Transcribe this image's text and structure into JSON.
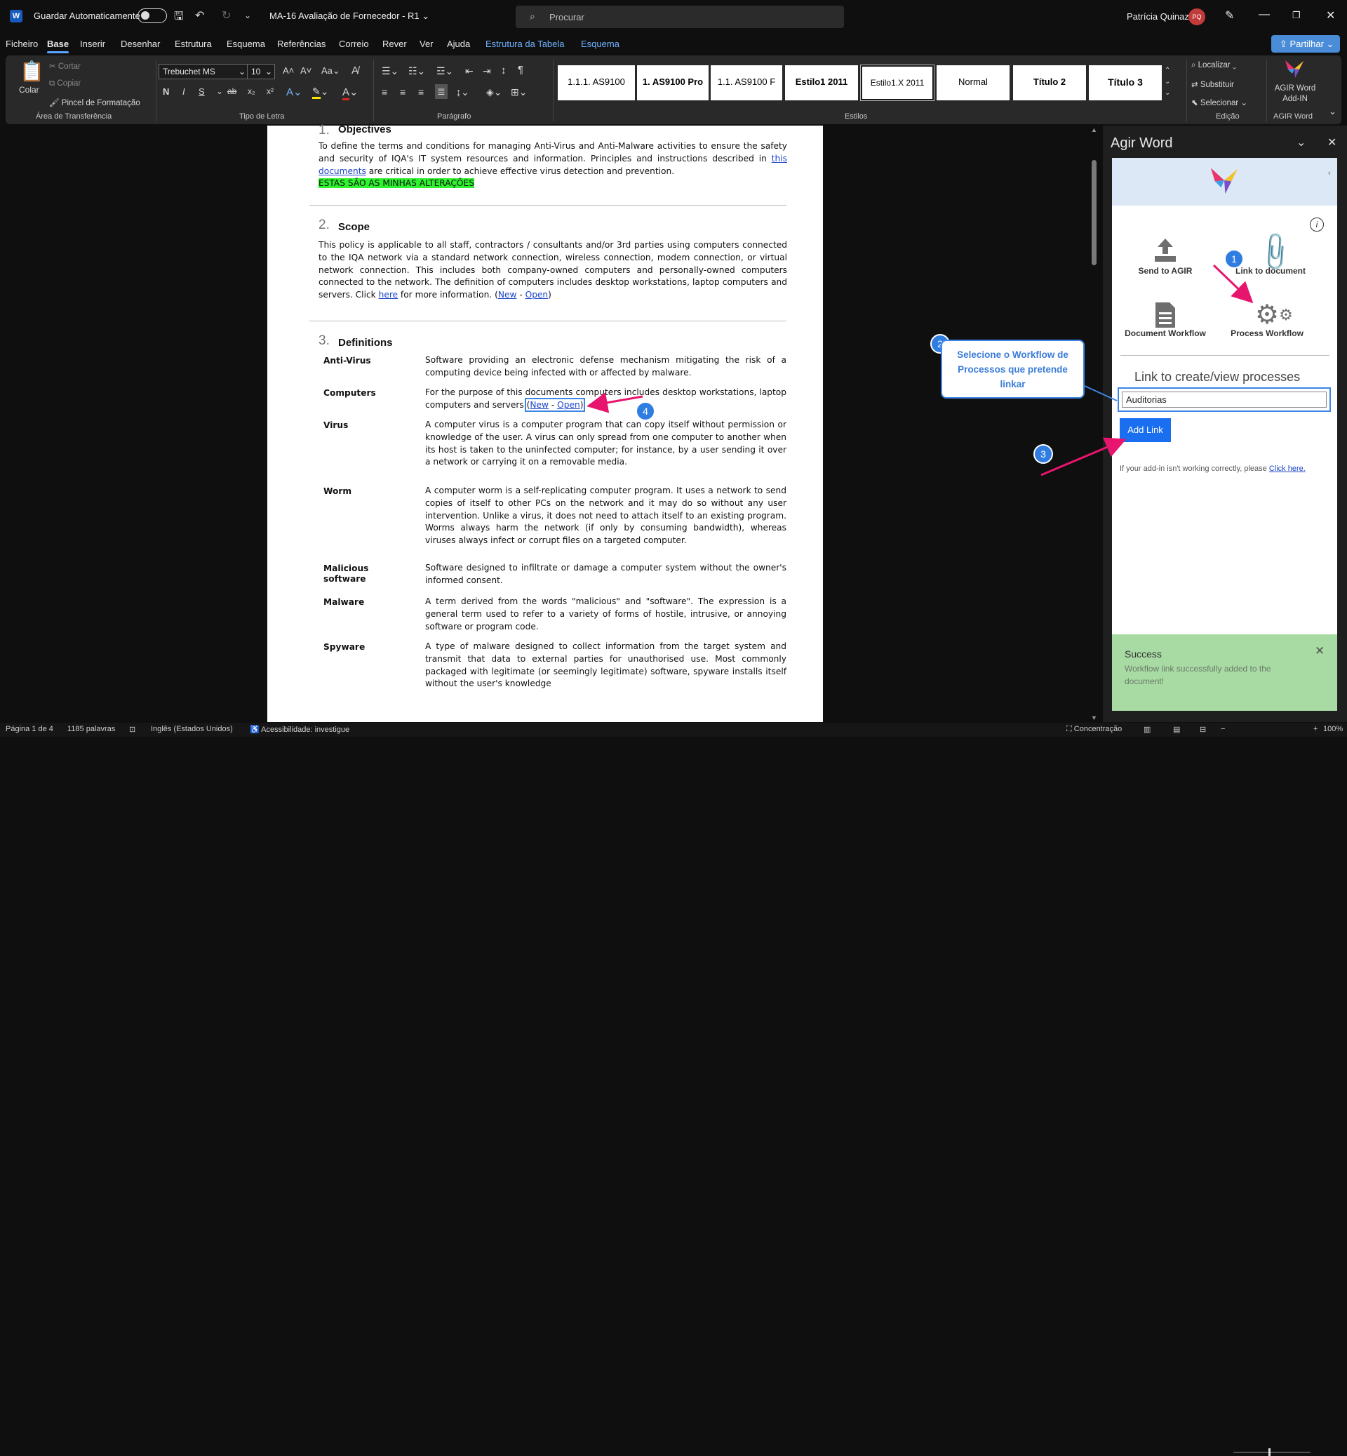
{
  "titlebar": {
    "app_icon": "W",
    "autosave_label": "Guardar Automaticamente",
    "doc_title": "MA-16 Avaliação de Fornecedor - R1",
    "search_placeholder": "Procurar",
    "user_name": "Patrícia Quinaz",
    "user_initials": "PQ"
  },
  "menu": {
    "tabs": [
      "Ficheiro",
      "Base",
      "Inserir",
      "Desenhar",
      "Estrutura",
      "Esquema",
      "Referências",
      "Correio",
      "Rever",
      "Ver",
      "Ajuda",
      "Estrutura da Tabela",
      "Esquema"
    ],
    "active_tab": "Base",
    "share_label": "Partilhar"
  },
  "ribbon": {
    "clipboard": {
      "paste": "Colar",
      "cut": "Cortar",
      "copy": "Copiar",
      "format_painter": "Pincel de Formatação",
      "group_label": "Área de Transferência"
    },
    "font": {
      "family": "Trebuchet MS",
      "size": "10",
      "change_case": "Aa",
      "bold": "N",
      "italic": "I",
      "underline": "S",
      "strike": "ab",
      "subscript": "x₂",
      "superscript": "x²",
      "group_label": "Tipo de Letra"
    },
    "paragraph": {
      "group_label": "Parágrafo"
    },
    "styles": {
      "items": [
        "1.1.1. AS9100",
        "1. AS9100 Pro",
        "1.1. AS9100 F",
        "Estilo1 2011",
        "Estilo1.X 2011",
        "Normal",
        "Título 2",
        "Título 3"
      ],
      "group_label": "Estilos"
    },
    "editing": {
      "find": "Localizar",
      "replace": "Substituir",
      "select": "Selecionar",
      "group_label": "Edição"
    },
    "agir": {
      "button_line1": "AGIR Word",
      "button_line2": "Add-IN",
      "group_label": "AGIR Word"
    }
  },
  "document": {
    "sections": [
      {
        "num": "1.",
        "title": "Objectives",
        "text_before": "To define the terms and conditions for managing Anti-Virus and Anti-Malware activities to ensure the safety and security of IQA's IT system resources and information. Principles and instructions described in ",
        "link": "this documents",
        "text_after": " are critical in order to achieve effective virus detection and prevention.",
        "highlight": "ESTAS SÃO AS MINHAS ALTERAÇÕES"
      },
      {
        "num": "2.",
        "title": "Scope",
        "text_before": "This policy is applicable to all staff, contractors / consultants and/or 3rd parties using computers connected to the IQA network via a standard network connection, wireless connection, modem connection, or virtual network connection. This includes both company-owned computers and personally-owned computers connected to the network. The definition of computers includes desktop workstations, laptop computers and servers. Click ",
        "link": "here",
        "text_after": " for more information. (",
        "link_new": "New",
        "link_sep": " - ",
        "link_open": "Open",
        "close": ")"
      },
      {
        "num": "3.",
        "title": "Definitions"
      }
    ],
    "definitions": [
      {
        "term": "Anti-Virus",
        "body": "Software providing an electronic defense mechanism mitigating the risk of a computing device being infected with or affected by malware."
      },
      {
        "term": "Computers",
        "body": "For the purpose of this documents computers includes desktop workstations, laptop computers and servers ",
        "link_new": "New",
        "link_open": "Open"
      },
      {
        "term": "Virus",
        "body": "A computer virus is a computer program that can copy itself without permission or knowledge of the user. A virus can only spread from one computer to another when its host is taken to the uninfected computer; for instance, by a user sending it over a network or carrying it on a removable media."
      },
      {
        "term": "Worm",
        "body": "A computer worm is a self-replicating computer program. It uses a network to send copies of itself to other PCs on the network and it may do so without any user intervention. Unlike a virus, it does not need to attach itself to an existing program. Worms always harm the network (if only by consuming bandwidth), whereas viruses always infect or corrupt files on a targeted computer."
      },
      {
        "term": "Malicious software",
        "body": "Software designed to infiltrate or damage a computer system without the owner's informed consent."
      },
      {
        "term": "Malware",
        "body": "A term derived from the words \"malicious\" and \"software\". The expression is a general term used to refer to a variety of forms of hostile, intrusive, or annoying software or program code."
      },
      {
        "term": "Spyware",
        "body": "A type of malware designed to collect information from the target system and transmit that data to external parties for unauthorised use. Most commonly packaged with legitimate (or seemingly legitimate) software, spyware installs itself without the user's knowledge"
      }
    ]
  },
  "pane": {
    "title": "Agir Word",
    "send_to_agir": "Send to AGIR",
    "link_to_document": "Link to document",
    "document_workflow": "Document Workflow",
    "process_workflow": "Process Workflow",
    "heading": "Link to create/view processes",
    "input_value": "Auditorias",
    "add_link": "Add Link",
    "help_text": "If your add-in isn't working correctly, please ",
    "help_link": "Click here.",
    "success_title": "Success",
    "success_message": "Workflow link successfully added to the document!"
  },
  "annotations": {
    "steps": [
      "1",
      "2",
      "3",
      "4"
    ],
    "callout": "Selecione o Workflow de Processos que pretende linkar",
    "arrow_color": "#e8156e",
    "highlight_color": "#3d86e6"
  },
  "statusbar": {
    "page": "Página 1 de 4",
    "words": "1185 palavras",
    "language": "Inglês (Estados Unidos)",
    "accessibility": "Acessibilidade: investigue",
    "focus": "Concentração",
    "zoom": "100%"
  },
  "colors": {
    "accent": "#4a8cd8",
    "highlight_green": "#2ef32e",
    "success_bg": "#a8dba3",
    "add_link_bg": "#1a6ef0"
  }
}
